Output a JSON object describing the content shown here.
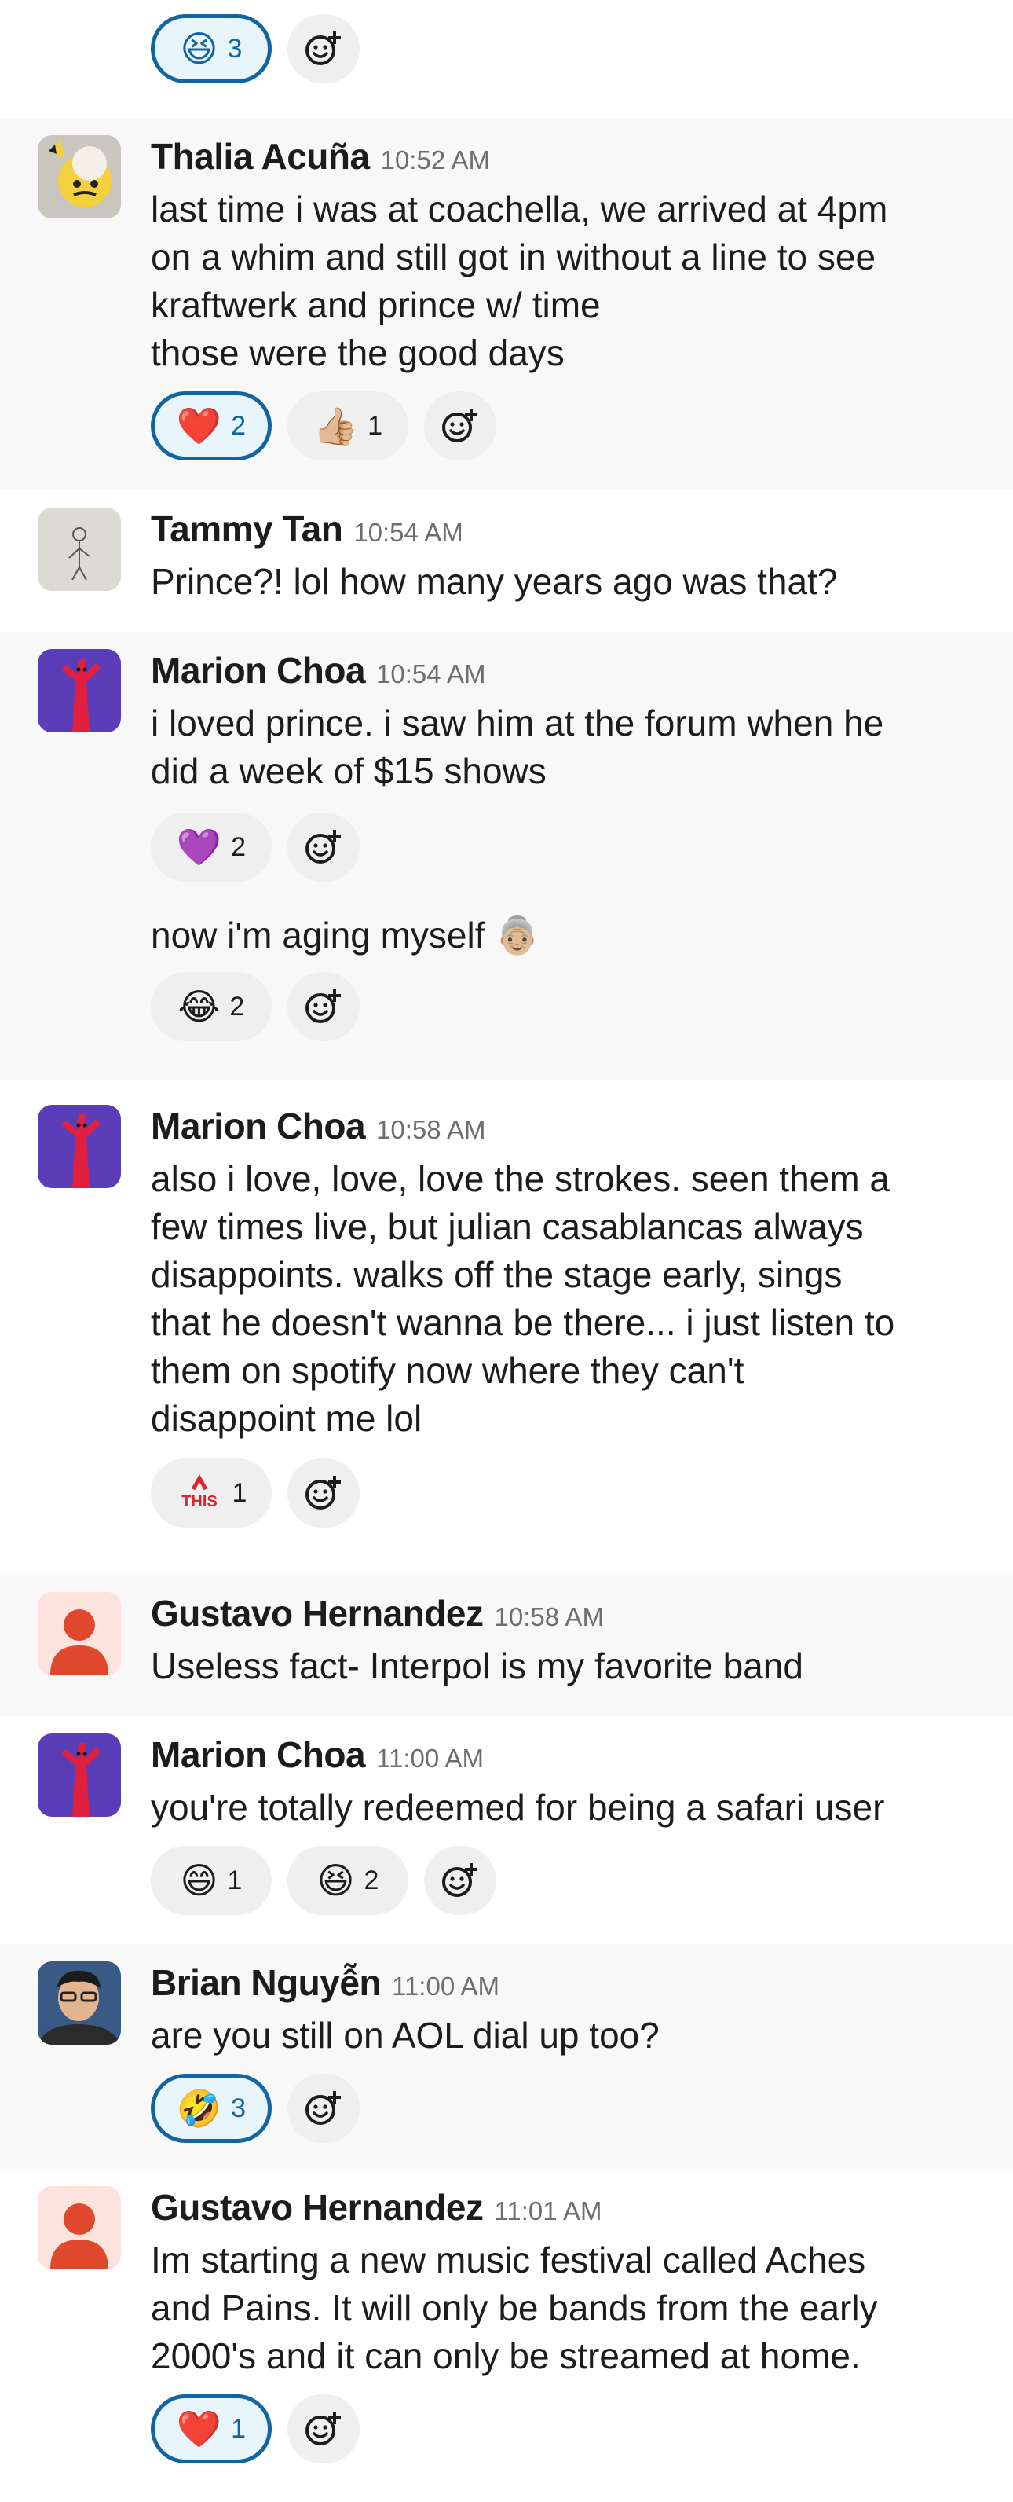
{
  "colors": {
    "accent": "#1264a3",
    "pill_bg": "#efefef",
    "mine_bg": "#e8f5fa",
    "text": "#1d1c1d",
    "muted": "#6e6e6e"
  },
  "top": {
    "reactions": [
      {
        "emoji": "😆",
        "count": "3",
        "mine": true
      }
    ]
  },
  "messages": [
    {
      "author": "Thalia Acuña",
      "time": "10:52 AM",
      "text": "last time i was at coachella, we arrived at 4pm\non a whim and still got in without a line to see\nkraftwerk and prince w/ time\nthose were the good days",
      "reactions": [
        {
          "emoji": "❤️",
          "count": "2",
          "mine": true
        },
        {
          "emoji": "👍🏼",
          "count": "1",
          "mine": false
        }
      ]
    },
    {
      "author": "Tammy Tan",
      "time": "10:54 AM",
      "text": "Prince?! lol how many years ago was that?"
    },
    {
      "author": "Marion Choa",
      "time": "10:54 AM",
      "text": "i loved prince. i saw him at the forum when he\ndid a week of $15 shows",
      "reactions": [
        {
          "emoji": "💜",
          "count": "2",
          "mine": false
        }
      ]
    },
    {
      "author": "",
      "time": "",
      "text": "now i'm aging myself 👵🏼",
      "reactions": [
        {
          "emoji": "😂",
          "count": "2",
          "mine": false
        }
      ]
    },
    {
      "author": "Marion Choa",
      "time": "10:58 AM",
      "text": "also i love, love, love the strokes. seen them a\nfew times live, but julian casablancas always\ndisappoints. walks off the stage early, sings\nthat he doesn't wanna be there... i just listen to\nthem on spotify now where they can't\ndisappoint me lol",
      "reactions": [
        {
          "emoji": "THIS",
          "count": "1",
          "mine": false
        }
      ]
    },
    {
      "author": "Gustavo Hernandez",
      "time": "10:58 AM",
      "text": "Useless fact- Interpol is my favorite band"
    },
    {
      "author": "Marion Choa",
      "time": "11:00 AM",
      "text": "you're totally redeemed for being a safari user",
      "reactions": [
        {
          "emoji": "😄",
          "count": "1",
          "mine": false
        },
        {
          "emoji": "😆",
          "count": "2",
          "mine": false
        }
      ]
    },
    {
      "author": "Brian Nguyễn",
      "time": "11:00 AM",
      "text": "are you still on AOL dial up too?",
      "reactions": [
        {
          "emoji": "🤣",
          "count": "3",
          "mine": true
        }
      ]
    },
    {
      "author": "Gustavo Hernandez",
      "time": "11:01 AM",
      "text": "Im starting a new music festival called Aches\nand Pains. It will only be bands from the early\n2000's and it can only be streamed at home.",
      "reactions": [
        {
          "emoji": "❤️",
          "count": "1",
          "mine": true
        }
      ]
    }
  ]
}
